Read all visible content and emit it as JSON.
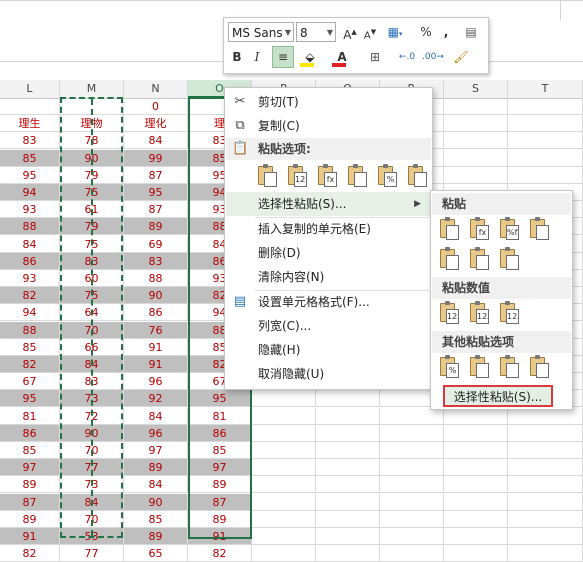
{
  "mini_toolbar": {
    "font_name": "MS Sans",
    "font_size": "8",
    "grow_font": "A",
    "shrink_font": "A",
    "percent": "%",
    "comma": ",",
    "bold": "B",
    "italic": "I",
    "font_color_letter": "A"
  },
  "columns": [
    "L",
    "M",
    "N",
    "O",
    "P",
    "Q",
    "R",
    "S",
    "T"
  ],
  "grid": {
    "row1": [
      "",
      "",
      "0",
      "",
      "",
      "",
      "",
      "",
      ""
    ],
    "headers": [
      "理生",
      "理物",
      "理化",
      "理"
    ],
    "rows": [
      [
        "83",
        "78",
        "84",
        "83"
      ],
      [
        "85",
        "90",
        "99",
        "85"
      ],
      [
        "95",
        "79",
        "87",
        "95"
      ],
      [
        "94",
        "75",
        "95",
        "94"
      ],
      [
        "93",
        "61",
        "87",
        "93"
      ],
      [
        "88",
        "79",
        "89",
        "88"
      ],
      [
        "84",
        "75",
        "69",
        "84"
      ],
      [
        "86",
        "83",
        "83",
        "86"
      ],
      [
        "93",
        "60",
        "88",
        "93"
      ],
      [
        "82",
        "75",
        "90",
        "82"
      ],
      [
        "94",
        "64",
        "86",
        "94"
      ],
      [
        "88",
        "70",
        "76",
        "88"
      ],
      [
        "85",
        "66",
        "91",
        "85"
      ],
      [
        "82",
        "84",
        "91",
        "82"
      ],
      [
        "67",
        "83",
        "96",
        "67"
      ],
      [
        "95",
        "73",
        "92",
        "95"
      ],
      [
        "81",
        "72",
        "84",
        "81"
      ],
      [
        "86",
        "90",
        "96",
        "86"
      ],
      [
        "85",
        "70",
        "97",
        "85"
      ],
      [
        "97",
        "77",
        "89",
        "97"
      ],
      [
        "89",
        "73",
        "84",
        "89"
      ],
      [
        "87",
        "84",
        "90",
        "87"
      ],
      [
        "89",
        "70",
        "85",
        "89"
      ],
      [
        "91",
        "53",
        "89",
        "91"
      ],
      [
        "82",
        "77",
        "65",
        "82"
      ]
    ]
  },
  "context_menu": {
    "cut": "剪切(T)",
    "copy": "复制(C)",
    "paste_options_header": "粘贴选项:",
    "paste_special": "选择性粘贴(S)...",
    "insert_copied": "插入复制的单元格(E)",
    "delete": "删除(D)",
    "clear_contents": "清除内容(N)",
    "format_cells": "设置单元格格式(F)...",
    "column_width": "列宽(C)...",
    "hide": "隐藏(H)",
    "unhide": "取消隐藏(U)",
    "paste_icons": [
      "",
      "123",
      "fx",
      "",
      "%",
      ""
    ]
  },
  "submenu": {
    "paste_header": "粘贴",
    "paste_values_header": "粘贴数值",
    "other_header": "其他粘贴选项",
    "paste_special_button": "选择性粘贴(S)...",
    "paste_row1": [
      "",
      "fx",
      "%fx",
      ""
    ],
    "paste_row2": [
      "",
      "",
      ""
    ],
    "values_row": [
      "123",
      "123",
      "123"
    ],
    "other_row": [
      "%",
      "",
      "",
      ""
    ]
  }
}
